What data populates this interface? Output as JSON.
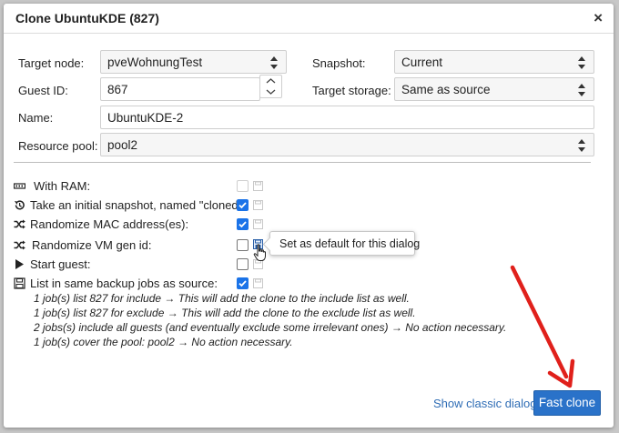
{
  "dialog": {
    "title": "Clone UbuntuKDE (827)",
    "close_glyph": "×"
  },
  "form": {
    "target_node": {
      "label": "Target node:",
      "value": "pveWohnungTest"
    },
    "snapshot": {
      "label": "Snapshot:",
      "value": "Current"
    },
    "guest_id": {
      "label": "Guest ID:",
      "value": "867"
    },
    "target_storage": {
      "label": "Target storage:",
      "value": "Same as source"
    },
    "name": {
      "label": "Name:",
      "value": "UbuntuKDE-2"
    },
    "resource_pool": {
      "label": "Resource pool:",
      "value": "pool2"
    }
  },
  "options": [
    {
      "label": "With RAM:",
      "icon": "memory-icon",
      "checked": false,
      "disabled": true
    },
    {
      "label": "Take an initial snapshot, named \"cloned\":",
      "icon": "history-icon",
      "checked": true,
      "disabled": false
    },
    {
      "label": "Randomize MAC address(es):",
      "icon": "shuffle-icon",
      "checked": true,
      "disabled": false
    },
    {
      "label": "Randomize VM gen id:",
      "icon": "shuffle-icon",
      "checked": false,
      "disabled": false
    },
    {
      "label": "Start guest:",
      "icon": "play-icon",
      "checked": false,
      "disabled": false
    },
    {
      "label": "List in same backup jobs as source:",
      "icon": "save-icon",
      "checked": true,
      "disabled": false
    }
  ],
  "backup_info": [
    "1 job(s) list 827 for include → This will add the clone to the include list as well.",
    "1 job(s) list 827 for exclude → This will add the clone to the exclude list as well.",
    "2 jobs(s) include all guests (and eventually exclude some irrelevant ones) → No action necessary.",
    "1 job(s) cover the pool: pool2 → No action necessary."
  ],
  "tooltip": {
    "text": "Set as default for this dialog"
  },
  "footer": {
    "classic_link": "Show classic dialog",
    "fast_clone_button": "Fast clone"
  },
  "colors": {
    "accent": "#2a72c9",
    "checkbox": "#1a73e8",
    "link": "#2f6db5",
    "arrow": "#e0201b"
  }
}
